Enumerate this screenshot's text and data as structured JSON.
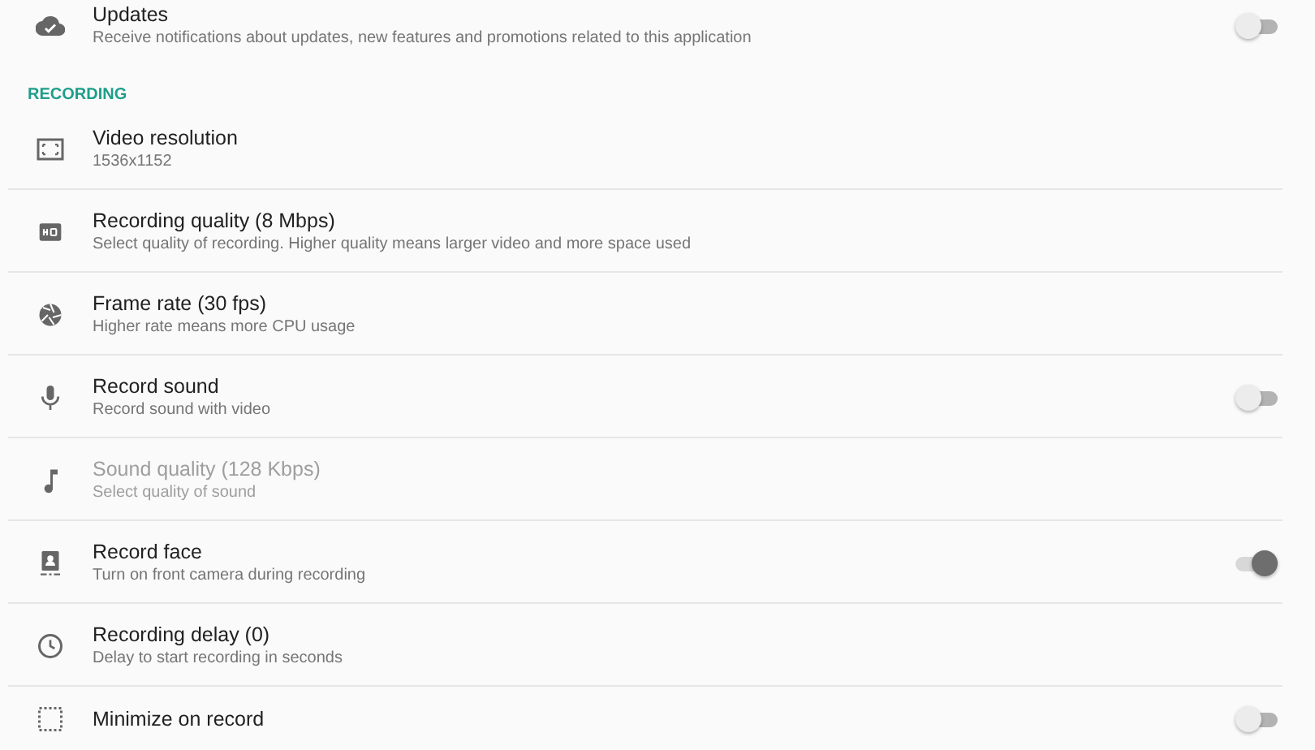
{
  "top_items": [
    {
      "title": "Updates",
      "subtitle": "Receive notifications about updates, new features and promotions related to this application",
      "kind": "switch",
      "on": false,
      "disabled": false
    }
  ],
  "section": {
    "header": "RECORDING",
    "items": [
      {
        "title": "Video resolution",
        "subtitle": "1536x1152",
        "kind": "plain",
        "disabled": false
      },
      {
        "title": "Recording quality (8 Mbps)",
        "subtitle": "Select quality of recording. Higher quality means larger video and more space used",
        "kind": "plain",
        "disabled": false
      },
      {
        "title": "Frame rate (30 fps)",
        "subtitle": "Higher rate means more CPU usage",
        "kind": "plain",
        "disabled": false
      },
      {
        "title": "Record sound",
        "subtitle": "Record sound with video",
        "kind": "switch",
        "on": false,
        "disabled": false
      },
      {
        "title": "Sound quality (128 Kbps)",
        "subtitle": "Select quality of sound",
        "kind": "plain",
        "disabled": true
      },
      {
        "title": "Record face",
        "subtitle": "Turn on front camera during recording",
        "kind": "switch",
        "on": true,
        "disabled": false
      },
      {
        "title": "Recording delay (0)",
        "subtitle": "Delay to start recording in seconds",
        "kind": "plain",
        "disabled": false
      },
      {
        "title": "Minimize on record",
        "kind": "switch",
        "on": false,
        "disabled": false
      }
    ]
  }
}
